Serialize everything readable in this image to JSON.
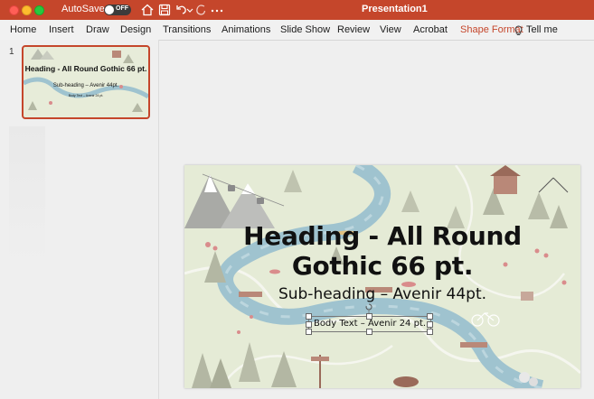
{
  "titlebar": {
    "autosave_label": "AutoSave",
    "autosave_state": "OFF",
    "document_title": "Presentation1",
    "icons": [
      "home-icon",
      "save-icon",
      "undo-icon",
      "redo-icon",
      "more-icon"
    ]
  },
  "ribbon": {
    "tabs": [
      {
        "label": "Home"
      },
      {
        "label": "Insert"
      },
      {
        "label": "Draw"
      },
      {
        "label": "Design"
      },
      {
        "label": "Transitions"
      },
      {
        "label": "Animations"
      },
      {
        "label": "Slide Show"
      },
      {
        "label": "Review"
      },
      {
        "label": "View"
      },
      {
        "label": "Acrobat"
      },
      {
        "label": "Shape Format"
      }
    ],
    "active_tab": "Shape Format",
    "tell_me": "Tell me"
  },
  "thumbnails": [
    {
      "number": "1",
      "heading": "Heading - All Round Gothic 66 pt.",
      "subheading": "Sub-heading – Avenir 44pt.",
      "body": "Body Text – Avenir 24 pt."
    }
  ],
  "slide": {
    "heading_line1": "Heading - All Round",
    "heading_line2": "Gothic 66 pt.",
    "subheading": "Sub-heading – Avenir 44pt.",
    "body": "Body Text – Avenir 24 pt."
  },
  "colors": {
    "accent": "#c5462b",
    "slide_background": "#e5ebd6",
    "river": "#9fc3cf",
    "tree": "#b3b7a3"
  }
}
